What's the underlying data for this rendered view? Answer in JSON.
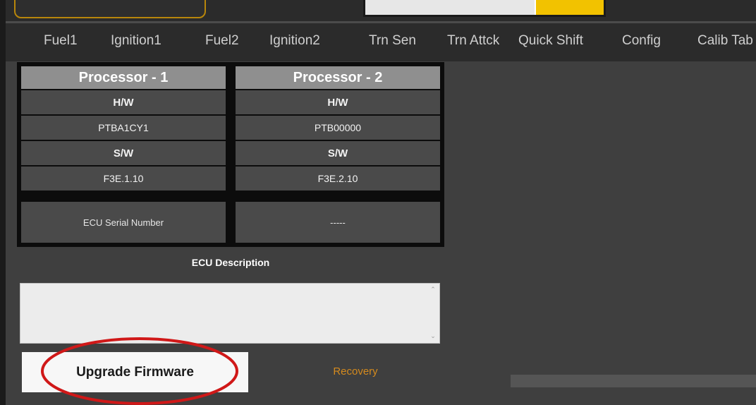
{
  "menu": {
    "tabs": [
      {
        "label": "Fuel1"
      },
      {
        "label": "Ignition1"
      },
      {
        "label": "Fuel2"
      },
      {
        "label": "Ignition2"
      },
      {
        "label": "Trn Sen"
      },
      {
        "label": "Trn Attck"
      },
      {
        "label": "Quick Shift"
      },
      {
        "label": "Config"
      },
      {
        "label": "Calib Tab"
      }
    ]
  },
  "processors": [
    {
      "title": "Processor - 1",
      "hw_label": "H/W",
      "hw_value": "PTBA1CY1",
      "sw_label": "S/W",
      "sw_value": "F3E.1.10"
    },
    {
      "title": "Processor - 2",
      "hw_label": "H/W",
      "hw_value": "PTB00000",
      "sw_label": "S/W",
      "sw_value": "F3E.2.10"
    }
  ],
  "ecu": {
    "serial_label": "ECU Serial Number",
    "serial_value": "-----",
    "description_label": "ECU Description",
    "description_value": ""
  },
  "actions": {
    "upgrade_label": "Upgrade Firmware",
    "recovery_label": "Recovery"
  },
  "colors": {
    "accent_orange": "#d48a1e",
    "highlight_red": "#d01818",
    "panel_dark": "#3f3f3f"
  }
}
